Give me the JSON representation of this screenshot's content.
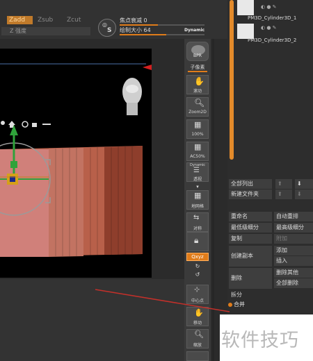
{
  "brush_mode": {
    "zadd": "Zadd",
    "zsub": "Zsub",
    "zcut": "Zcut"
  },
  "intensity_label": "Z 强度",
  "symmetry": {
    "label": "S"
  },
  "focal_shift": {
    "label": "焦点衰减",
    "value": "0",
    "level": 0.45
  },
  "draw_size": {
    "label": "绘制大小",
    "value": "64",
    "level": 0.55
  },
  "dynamic_label": "Dynamic",
  "toolbar": {
    "bpr": "BPR",
    "subpixel": "子像素",
    "scroll": "滚动",
    "zoom2d": "Zoom2D",
    "pct100": "100%",
    "ac50": "AC50%",
    "dynamic": "Dynamic",
    "persp": "透视",
    "floor": "地网格",
    "local": "对称",
    "xyz": "Qxyz",
    "frame": "中心点",
    "move": "移动",
    "scale": "缩放"
  },
  "subtools": [
    "PM3D_Cylinder3D_1",
    "PM3D_Cylinder3D_2"
  ],
  "panel": {
    "list_all": "全部列出",
    "new_folder": "新建文件夹",
    "rename": "重命名",
    "auto_reorder": "自动重排",
    "lowest_res": "最低级细分",
    "highest_res": "最高级细分",
    "duplicate": "复制",
    "append": "附加",
    "create_copy": "创建副本",
    "add": "添加",
    "insert": "插入",
    "delete": "删除",
    "delete_other": "删除其他",
    "delete_all": "全部删除",
    "split": "拆分",
    "merge": "合并"
  },
  "watermark": "软件技巧",
  "colors": {
    "accent": "#e07c1a",
    "canvas": "#000000",
    "mesh": "#b8604a"
  }
}
